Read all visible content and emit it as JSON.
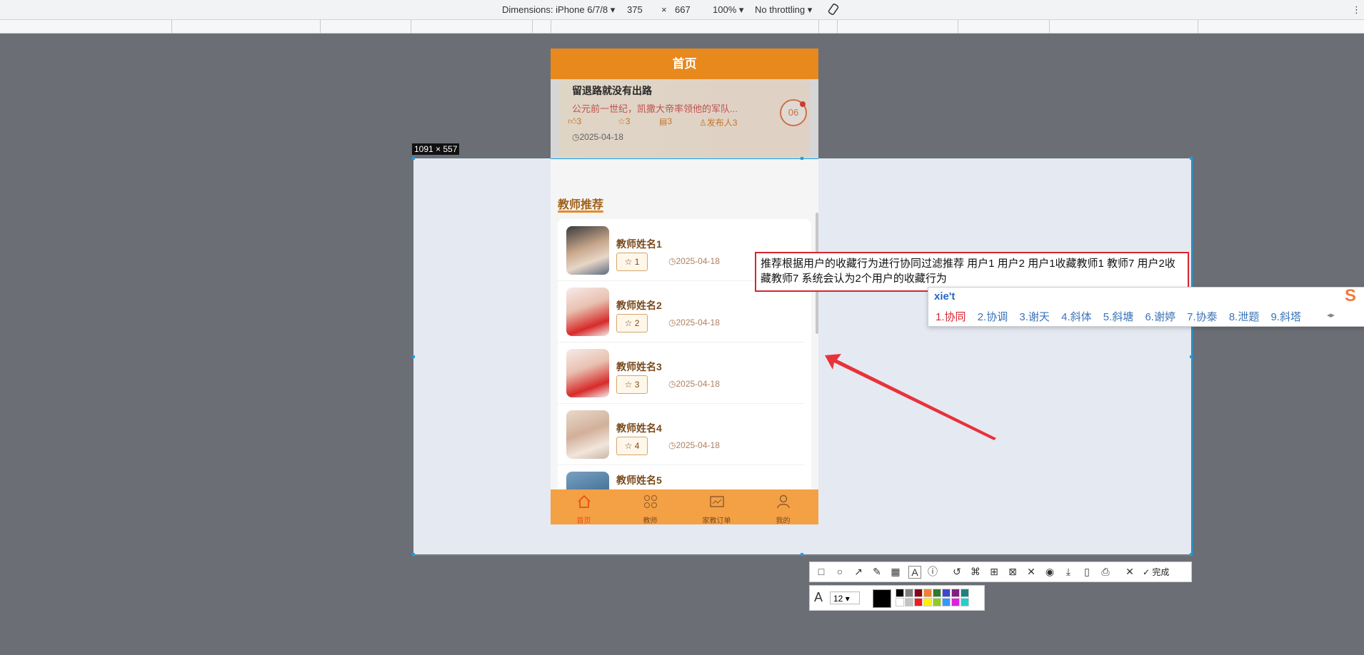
{
  "devtools": {
    "dimensions_label": "Dimensions: iPhone 6/7/8 ▾",
    "width": "375",
    "times": "×",
    "height": "667",
    "zoom": "100% ▾",
    "throttling": "No throttling ▾",
    "more": "⋮"
  },
  "phone": {
    "header_title": "首页",
    "article": {
      "title": "留退路就没有出路",
      "summary": "公元前一世纪，凯撒大帝率领他的军队...",
      "likes": "3",
      "stars": "3",
      "comments": "3",
      "publisher": "发布人3",
      "date": "2025-04-18",
      "badge": "06"
    },
    "section_title": "教师推荐",
    "teachers": [
      {
        "name": "教师姓名1",
        "fav": "1",
        "date": "2025-04-18"
      },
      {
        "name": "教师姓名2",
        "fav": "2",
        "date": "2025-04-18"
      },
      {
        "name": "教师姓名3",
        "fav": "3",
        "date": "2025-04-18"
      },
      {
        "name": "教师姓名4",
        "fav": "4",
        "date": "2025-04-18"
      },
      {
        "name": "教师姓名5",
        "fav": "",
        "date": ""
      }
    ],
    "tabs": [
      "首页",
      "教师",
      "家教订单",
      "我的"
    ],
    "colors": {
      "brand": "#e8891d",
      "tabbar": "#f4a045"
    }
  },
  "screenshot_tool": {
    "selection_size": "1091 × 557",
    "text_annotation": "推荐根据用户的收藏行为进行协同过滤推荐 用户1 用户2 用户1收藏教师1 教师7 用户2收藏教师7 系统会认为2个用户的收藏行为",
    "ime_input": "xie't",
    "ime_candidates": [
      "1.协同",
      "2.协调",
      "3.谢天",
      "4.斜体",
      "5.斜塘",
      "6.谢婷",
      "7.协泰",
      "8.泄题",
      "9.斜塔"
    ],
    "done_label": "完成",
    "font_size": "12",
    "arrow_color": "#e8323a"
  }
}
